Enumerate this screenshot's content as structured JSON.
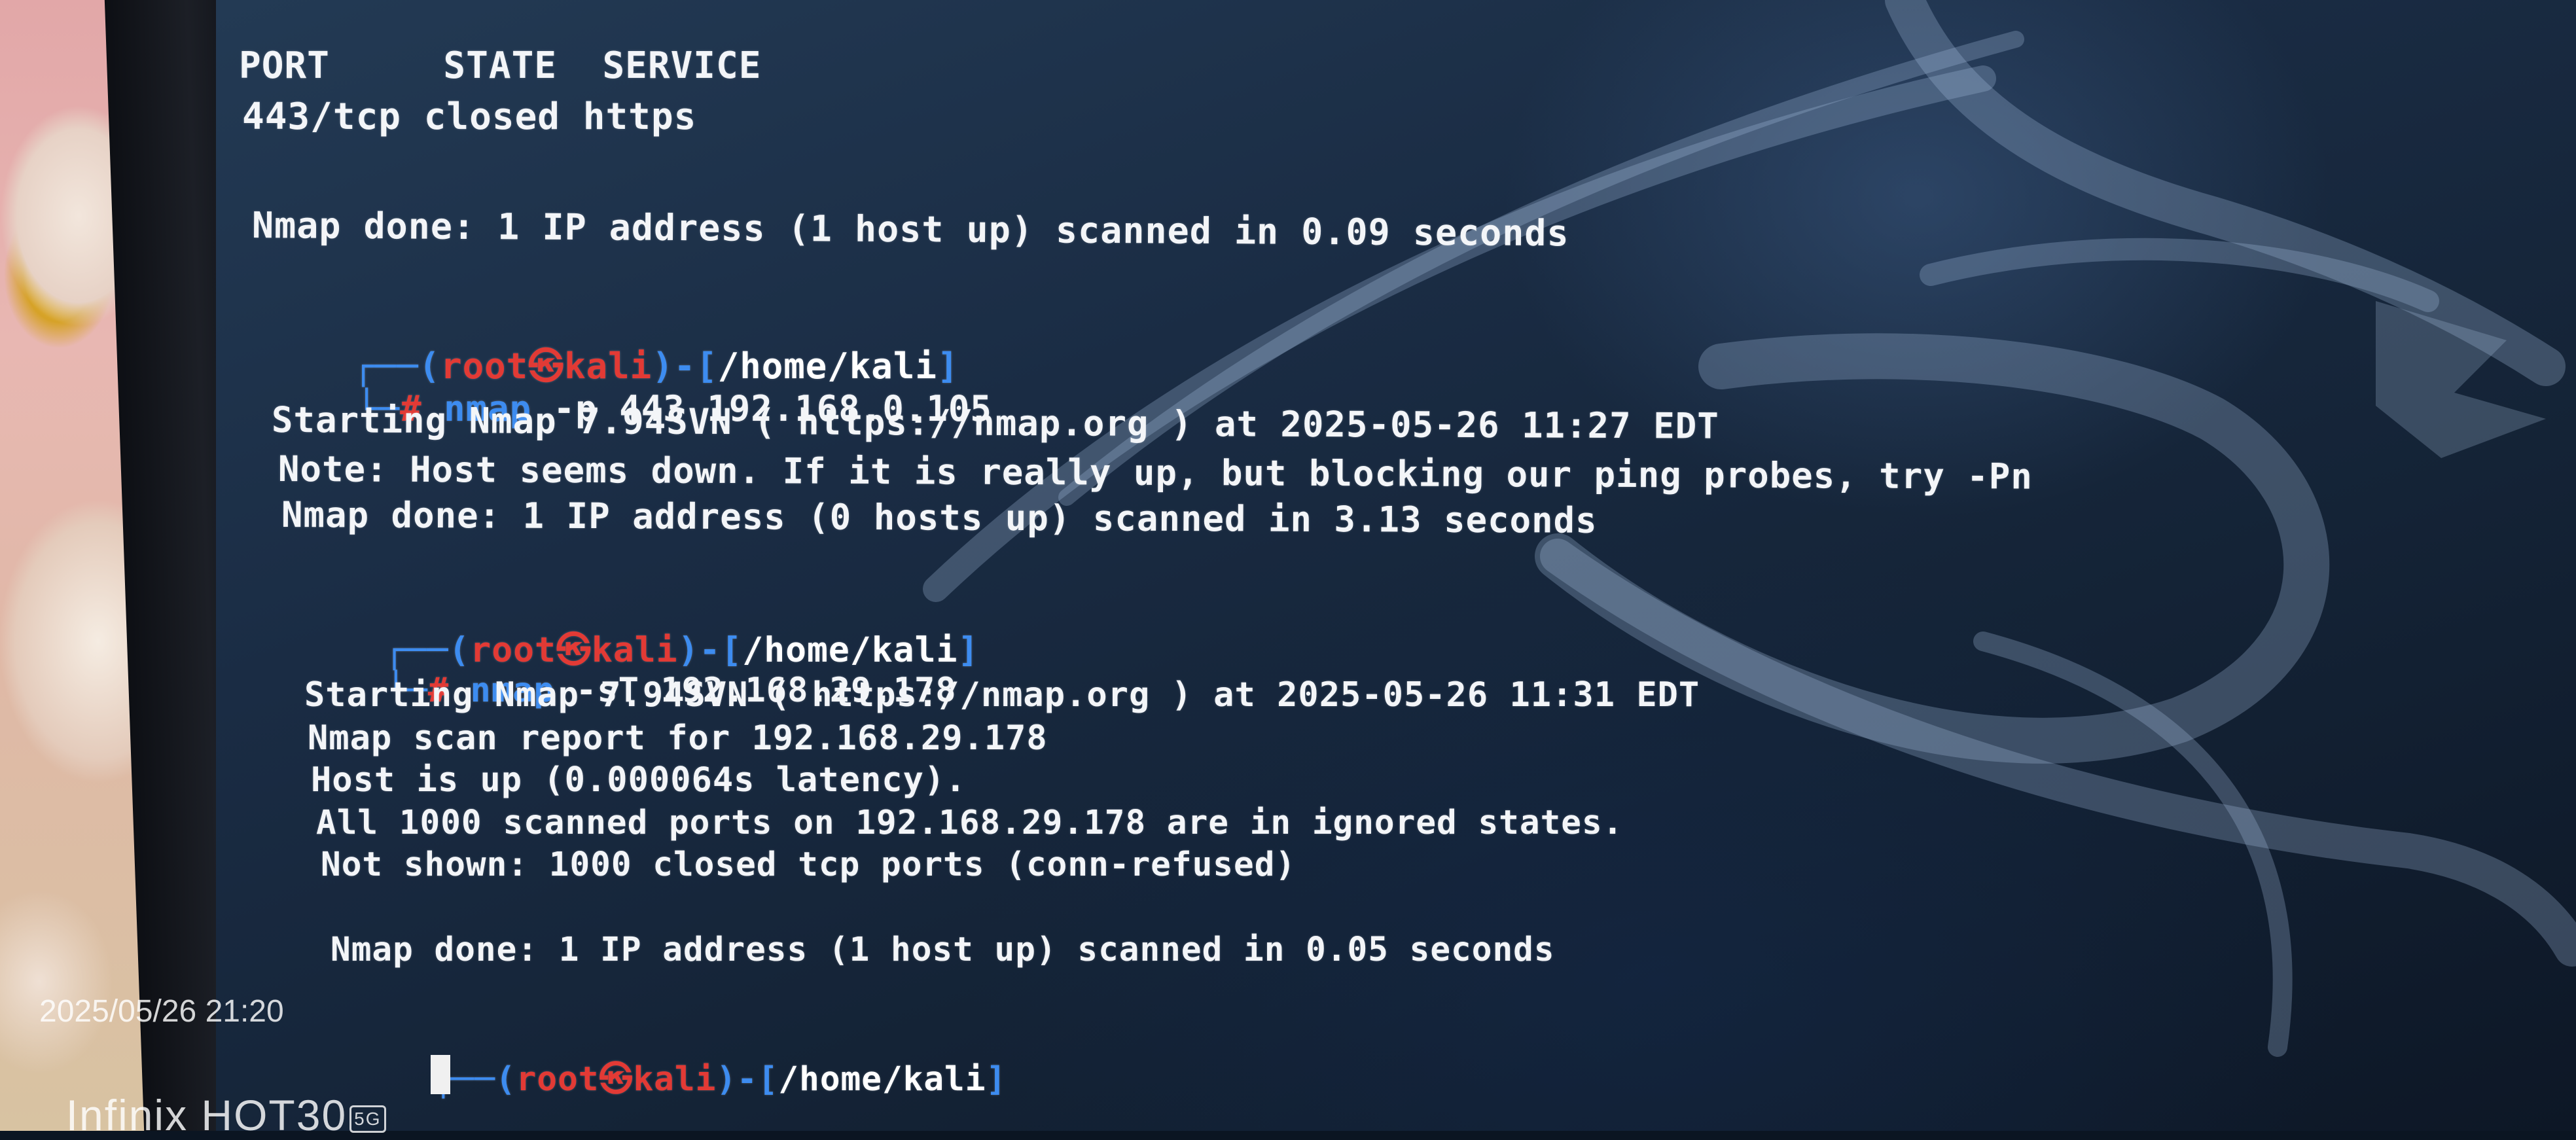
{
  "terminal": {
    "block1": {
      "header": "PORT     STATE  SERVICE",
      "row": "443/tcp closed https",
      "done": "Nmap done: 1 IP address (1 host up) scanned in 0.09 seconds"
    },
    "block2": {
      "prompt_open": "┌──(",
      "user_host": "root㉿kali",
      "prompt_mid": ")-[",
      "path": "/home/kali",
      "prompt_close": "]",
      "cmd_prefix": "└─",
      "hash": "#",
      "binary": "nmap",
      "args": "-p 443 192.168.0.105",
      "output": [
        "Starting Nmap 7.94SVN ( https://nmap.org ) at 2025-05-26 11:27 EDT",
        "Note: Host seems down. If it is really up, but blocking our ping probes, try -Pn",
        "Nmap done: 1 IP address (0 hosts up) scanned in 3.13 seconds"
      ]
    },
    "block3": {
      "prompt_open": "┌──(",
      "user_host": "root㉿kali",
      "prompt_mid": ")-[",
      "path": "/home/kali",
      "prompt_close": "]",
      "cmd_prefix": "└─",
      "hash": "#",
      "binary": "nmap",
      "args": "-sT 192.168.29.178",
      "output": [
        "Starting Nmap 7.94SVN ( https://nmap.org ) at 2025-05-26 11:31 EDT",
        "Nmap scan report for 192.168.29.178",
        "Host is up (0.000064s latency).",
        "All 1000 scanned ports on 192.168.29.178 are in ignored states.",
        "Not shown: 1000 closed tcp ports (conn-refused)",
        "Nmap done: 1 IP address (1 host up) scanned in 0.05 seconds"
      ]
    },
    "block4": {
      "prompt_open": "┌──(",
      "user_host": "root㉿kali",
      "prompt_mid": ")-[",
      "path": "/home/kali",
      "prompt_close": "]"
    }
  },
  "camera_watermark": {
    "timestamp": "2025/05/26 21:20",
    "device": "Infinix HOT30",
    "badge": "5G"
  },
  "colors": {
    "prompt_bracket": "#3d8cf0",
    "prompt_user": "#e23a35",
    "terminal_text": "#f3f5f8",
    "background": "#1a2c44"
  }
}
